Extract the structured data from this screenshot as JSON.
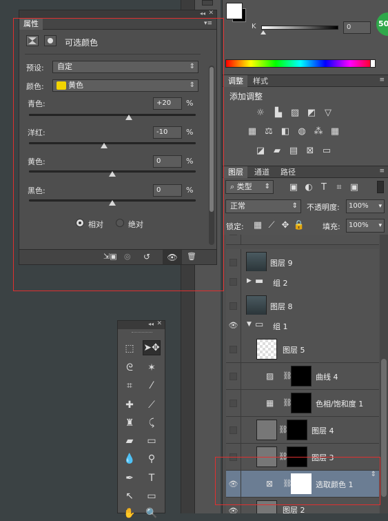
{
  "properties": {
    "tab": "属性",
    "title": "可选颜色",
    "preset_label": "预设:",
    "preset_value": "自定",
    "color_label": "颜色:",
    "color_value": "黄色",
    "color_swatch": "#f2d400",
    "sliders": [
      {
        "label": "青色:",
        "value": "+20",
        "unit": "%",
        "fraction": 0.6
      },
      {
        "label": "洋红:",
        "value": "-10",
        "unit": "%",
        "fraction": 0.45
      },
      {
        "label": "黄色:",
        "value": "0",
        "unit": "%",
        "fraction": 0.5
      },
      {
        "label": "黑色:",
        "value": "0",
        "unit": "%",
        "fraction": 0.5
      }
    ],
    "mode_relative": "相对",
    "mode_absolute": "绝对"
  },
  "color": {
    "k_label": "K",
    "k_value": "0"
  },
  "badge": "50",
  "adjustments": {
    "tabs": [
      "调整",
      "样式"
    ],
    "add_label": "添加调整"
  },
  "layers": {
    "tabs": [
      "图层",
      "通道",
      "路径"
    ],
    "filter": "类型",
    "blend": "正常",
    "opacity_label": "不透明度:",
    "opacity_value": "100%",
    "lock_label": "锁定:",
    "fill_label": "填充:",
    "fill_value": "100%",
    "items": [
      {
        "name": "图层 9",
        "visible": false
      },
      {
        "name": "组 2",
        "visible": false
      },
      {
        "name": "图层 8",
        "visible": false
      },
      {
        "name": "组 1",
        "visible": true
      },
      {
        "name": "图层 5",
        "visible": false
      },
      {
        "name": "曲线 4",
        "visible": false
      },
      {
        "name": "色相/饱和度 1",
        "visible": false
      },
      {
        "name": "图层 4",
        "visible": false
      },
      {
        "name": "图层 3",
        "visible": false
      },
      {
        "name": "选取颜色 1",
        "visible": true
      },
      {
        "name": "图层 2",
        "visible": true
      }
    ]
  }
}
